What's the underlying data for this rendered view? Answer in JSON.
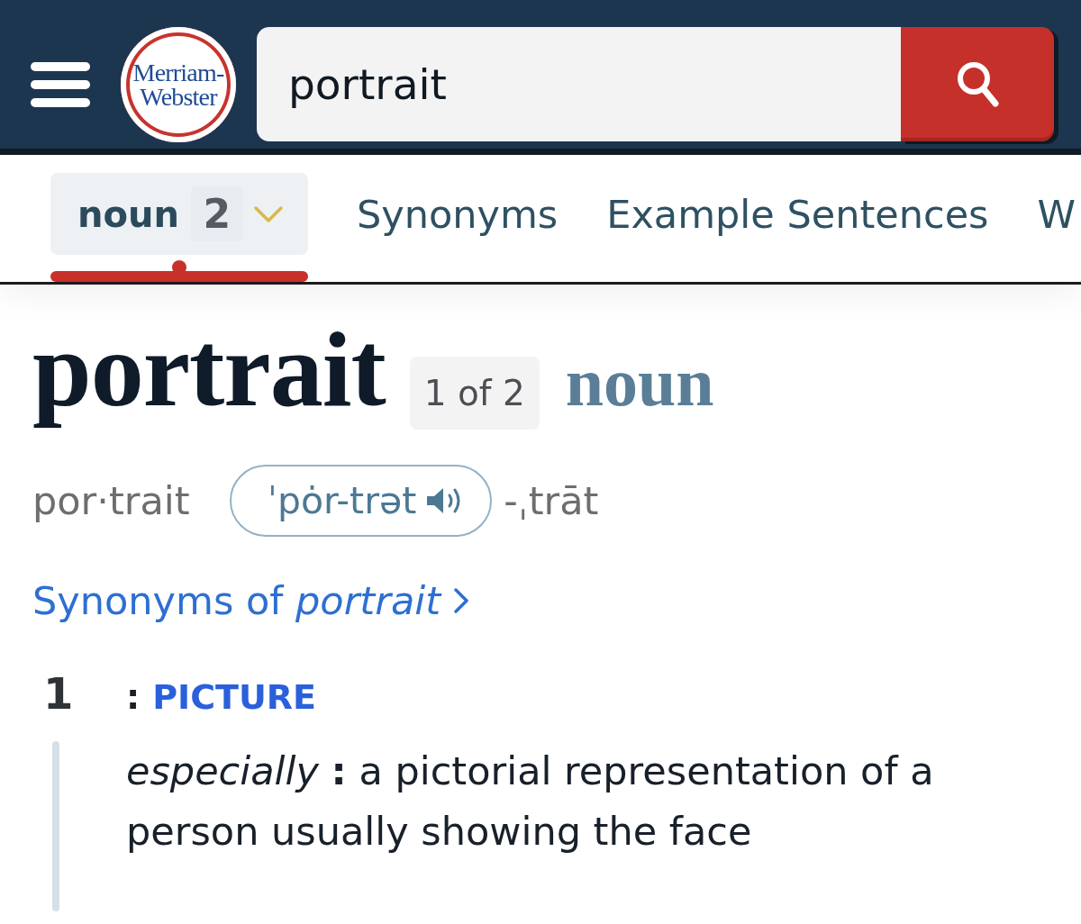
{
  "header": {
    "logo": {
      "lines": [
        "Merriam-",
        "Webster"
      ]
    },
    "search": {
      "value": "portrait"
    }
  },
  "tabs": [
    {
      "kind": "dropdown",
      "label": "noun",
      "count": "2",
      "selected": true
    },
    {
      "kind": "link",
      "label": "Synonyms",
      "selected": false
    },
    {
      "kind": "link",
      "label": "Example Sentences",
      "selected": false
    },
    {
      "kind": "link",
      "label": "W",
      "selected": false
    }
  ],
  "entry": {
    "headword": "portrait",
    "homograph": "1 of 2",
    "part_of_speech": "noun",
    "syllables": "por·trait",
    "pronunciation": "ˈpȯr-trət",
    "variant": "-ˌtrāt",
    "synonyms_link": "Synonyms of *portrait*"
  },
  "senses": [
    {
      "number": "1",
      "separator": ":",
      "cross_reference": "PICTURE",
      "definition": "*especially* **:** a pictorial representation of a person usually showing the face"
    }
  ]
}
